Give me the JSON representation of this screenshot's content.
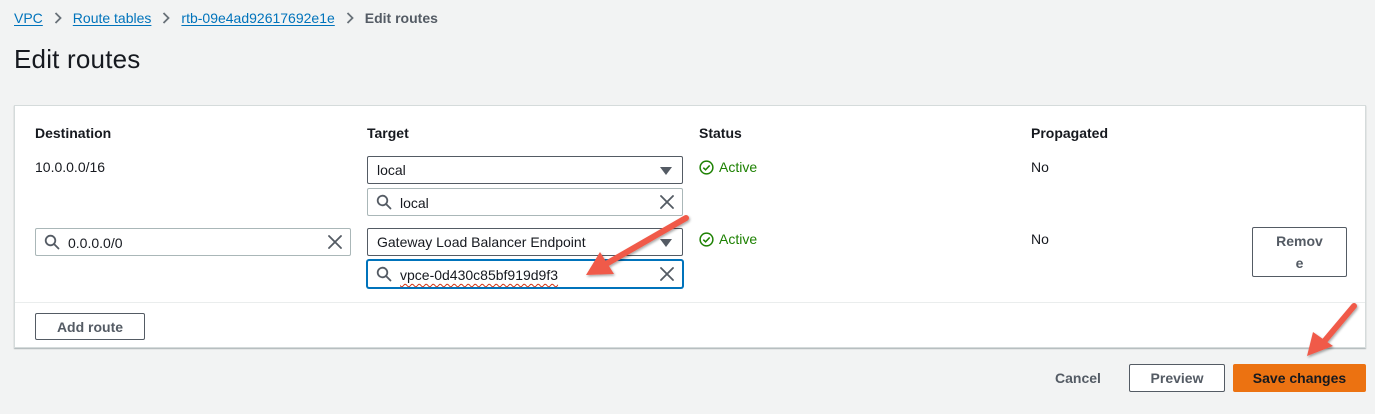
{
  "breadcrumb": {
    "items": [
      "VPC",
      "Route tables",
      "rtb-09e4ad92617692e1e"
    ],
    "current": "Edit routes"
  },
  "page": {
    "title": "Edit routes"
  },
  "table": {
    "headers": {
      "destination": "Destination",
      "target": "Target",
      "status": "Status",
      "propagated": "Propagated"
    },
    "rows": [
      {
        "destination": "10.0.0.0/16",
        "target_type": "local",
        "target_value": "local",
        "status": "Active",
        "propagated": "No"
      },
      {
        "destination": "0.0.0.0/0",
        "target_type": "Gateway Load Balancer Endpoint",
        "target_value": "vpce-0d430c85bf919d9f3",
        "status": "Active",
        "propagated": "No",
        "remove_label_line1": "Remov",
        "remove_label_line2": "e"
      }
    ]
  },
  "actions": {
    "add_route": "Add route",
    "cancel": "Cancel",
    "preview": "Preview",
    "save": "Save changes"
  },
  "colors": {
    "link": "#0073bb",
    "success": "#1d8102",
    "primary": "#ec7211",
    "annotation_arrow": "#f05a4a"
  },
  "icons": [
    "chevron-right-icon",
    "caret-down-icon",
    "search-icon",
    "clear-icon",
    "check-circle-icon",
    "annotation-arrow"
  ]
}
